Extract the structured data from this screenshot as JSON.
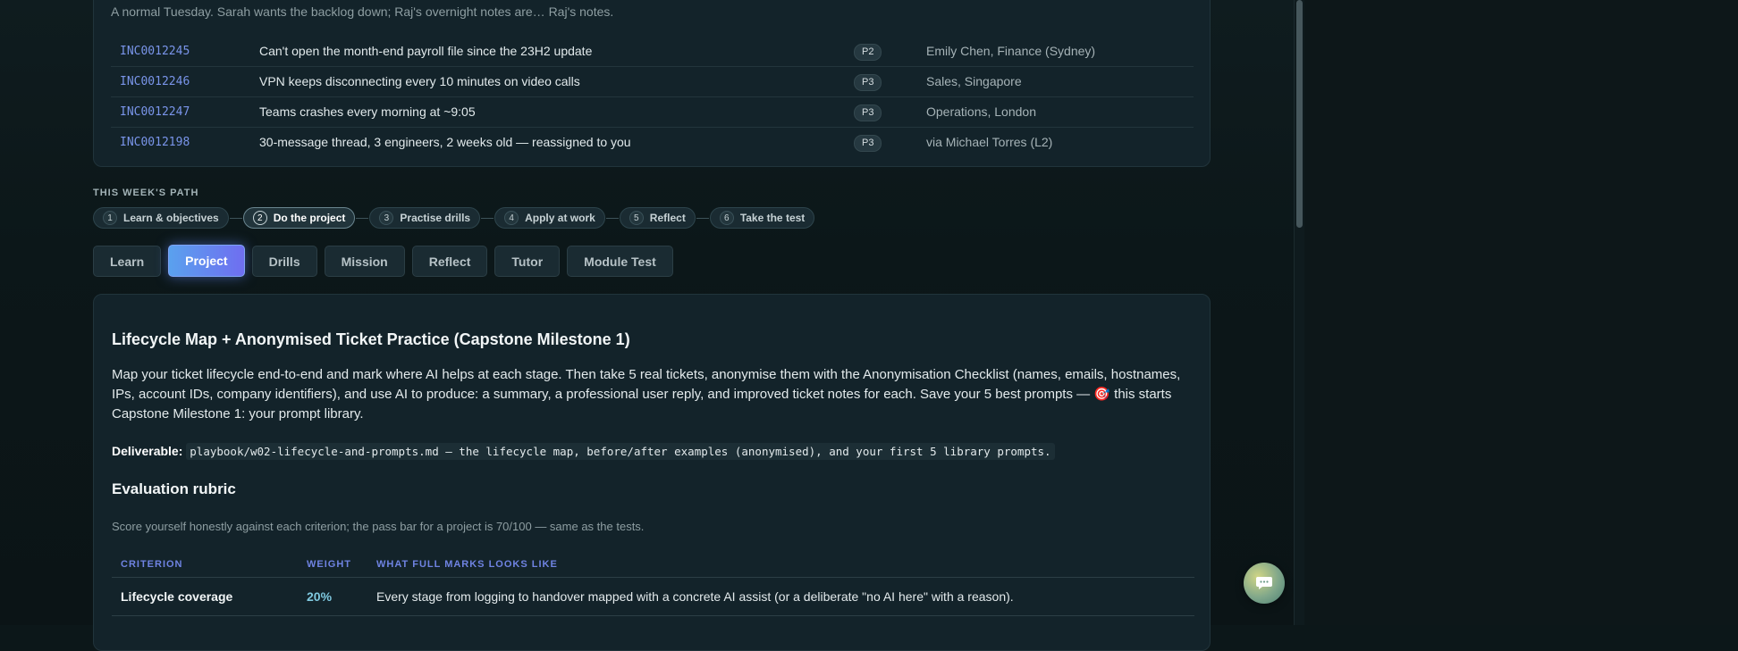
{
  "incidents": {
    "intro": "A normal Tuesday. Sarah wants the backlog down; Raj's overnight notes are… Raj's notes.",
    "tickets": [
      {
        "id": "INC0012245",
        "desc": "Can't open the month-end payroll file since the 23H2 update",
        "priority": "P2",
        "requester": "Emily Chen, Finance (Sydney)"
      },
      {
        "id": "INC0012246",
        "desc": "VPN keeps disconnecting every 10 minutes on video calls",
        "priority": "P3",
        "requester": "Sales, Singapore"
      },
      {
        "id": "INC0012247",
        "desc": "Teams crashes every morning at ~9:05",
        "priority": "P3",
        "requester": "Operations, London"
      },
      {
        "id": "INC0012198",
        "desc": "30-message thread, 3 engineers, 2 weeks old — reassigned to you",
        "priority": "P3",
        "requester": "via Michael Torres (L2)"
      }
    ]
  },
  "path": {
    "label": "THIS WEEK'S PATH",
    "steps": [
      {
        "num": "1",
        "label": "Learn & objectives"
      },
      {
        "num": "2",
        "label": "Do the project"
      },
      {
        "num": "3",
        "label": "Practise drills"
      },
      {
        "num": "4",
        "label": "Apply at work"
      },
      {
        "num": "5",
        "label": "Reflect"
      },
      {
        "num": "6",
        "label": "Take the test"
      }
    ],
    "active_step": "2"
  },
  "tabs": [
    "Learn",
    "Project",
    "Drills",
    "Mission",
    "Reflect",
    "Tutor",
    "Module Test"
  ],
  "active_tab": "Project",
  "project": {
    "title": "Lifecycle Map + Anonymised Ticket Practice (Capstone Milestone 1)",
    "body": "Map your ticket lifecycle end-to-end and mark where AI helps at each stage. Then take 5 real tickets, anonymise them with the Anonymisation Checklist (names, emails, hostnames, IPs, account IDs, company identifiers), and use AI to produce: a summary, a professional user reply, and improved ticket notes for each. Save your 5 best prompts — 🎯 this starts Capstone Milestone 1: your prompt library.",
    "deliverable_label": "Deliverable:",
    "deliverable_code": "playbook/w02-lifecycle-and-prompts.md — the lifecycle map, before/after examples (anonymised), and your first 5 library prompts."
  },
  "rubric": {
    "title": "Evaluation rubric",
    "note": "Score yourself honestly against each criterion; the pass bar for a project is 70/100 — same as the tests.",
    "headers": [
      "CRITERION",
      "WEIGHT",
      "WHAT FULL MARKS LOOKS LIKE"
    ],
    "rows": [
      {
        "criterion": "Lifecycle coverage",
        "weight": "20%",
        "desc": "Every stage from logging to handover mapped with a concrete AI assist (or a deliberate \"no AI here\" with a reason)."
      }
    ]
  },
  "colors": {
    "accent": "#6f6ef0",
    "link": "#7a95ea",
    "weight": "#7fc9e0"
  },
  "icons": {
    "chat_fab": "chat-bubble-icon"
  }
}
